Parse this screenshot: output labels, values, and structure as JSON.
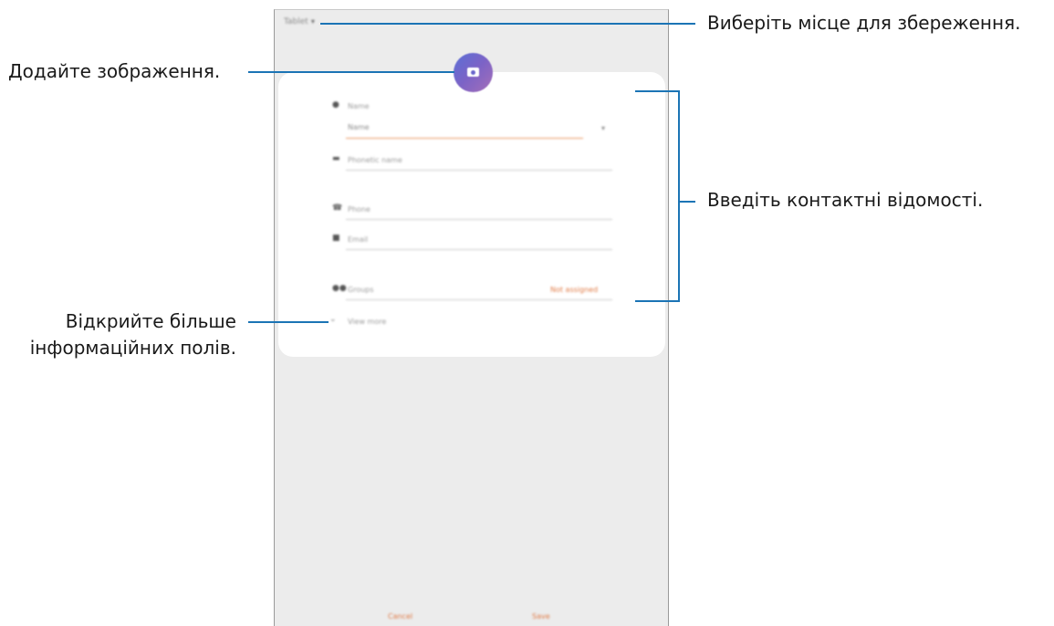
{
  "callouts": {
    "storage": "Виберіть місце для збереження.",
    "image": "Додайте зображення.",
    "details": "Введіть контактні відомості.",
    "more_line1": "Відкрийте більше",
    "more_line2": "інформаційних полів."
  },
  "screen": {
    "storage_location": "Tablet",
    "fields": {
      "name_header": "Name",
      "name_value": "Name",
      "phonetic": "Phonetic name",
      "phone": "Phone",
      "email": "Email",
      "groups": "Groups",
      "groups_value": "Not assigned",
      "view_more": "View more"
    },
    "buttons": {
      "cancel": "Cancel",
      "save": "Save"
    }
  },
  "colors": {
    "accent": "#e07a45",
    "callout_line": "#1b74b5",
    "avatar_start": "#5a6fd6",
    "avatar_end": "#a56fb8"
  },
  "icons": [
    "chevron-down-icon",
    "camera-icon",
    "person-icon",
    "phonetic-icon",
    "phone-icon",
    "email-icon",
    "groups-icon"
  ]
}
